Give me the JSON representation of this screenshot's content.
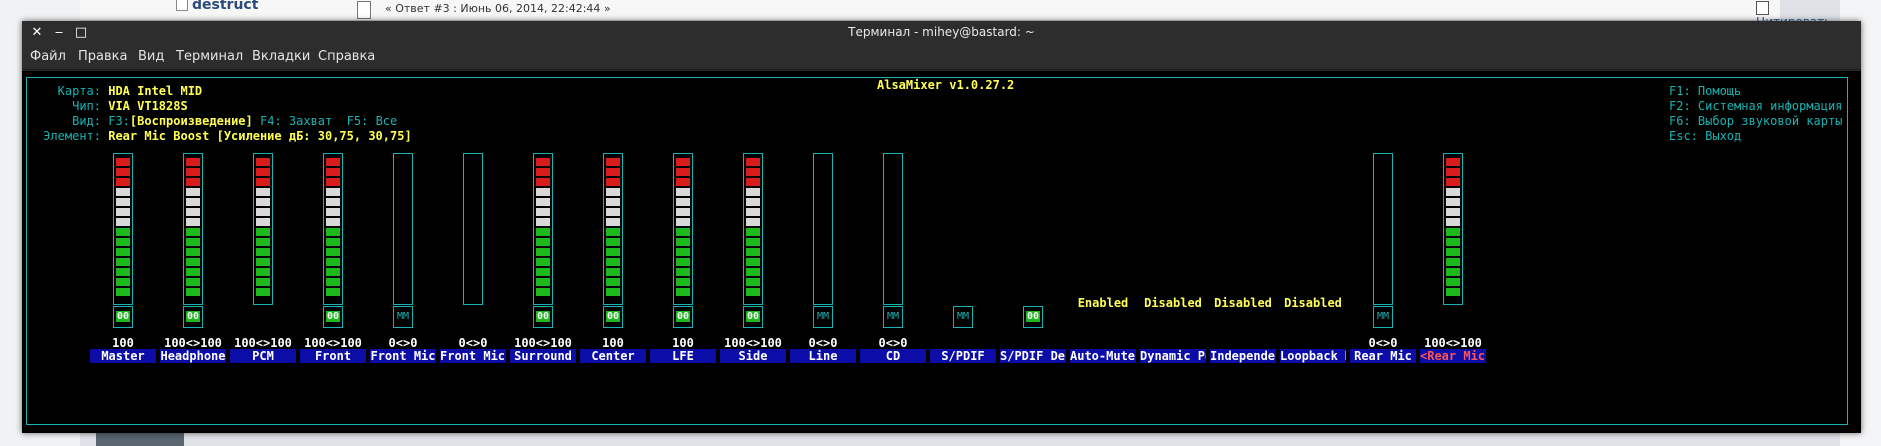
{
  "background": {
    "forum_user": "destruct",
    "post_ref": "« Ответ #3 : Июнь 06, 2014, 22:42:44 »",
    "quote_label": "Цитировать"
  },
  "window": {
    "title": "Терминал - mihey@bastard: ~",
    "close_glyph": "✕",
    "minimize_glyph": "‒",
    "maximize_glyph": "□"
  },
  "menu": [
    {
      "label": "Файл"
    },
    {
      "label": "Правка"
    },
    {
      "label": "Вид"
    },
    {
      "label": "Терминал"
    },
    {
      "label": "Вкладки"
    },
    {
      "label": "Справка"
    }
  ],
  "alsamixer": {
    "title": "AlsaMixer v1.0.27.2",
    "card_label": "Карта:",
    "card_value": "HDA Intel MID",
    "chip_label": "Чип:",
    "chip_value": "VIA VT1828S",
    "view_label": "Вид:",
    "view_f3": "F3:",
    "view_playback": "[Воспроизведение]",
    "view_rest": " F4: Захват  F5: Все",
    "element_label": "Элемент:",
    "element_value": "Rear Mic Boost [Усиление дБ: 30,75, 30,75]",
    "help": [
      "F1: Помощь",
      "F2: Системная информация",
      "F6: Выбор звуковой карты",
      "Esc: Выход"
    ]
  },
  "channels": [
    {
      "name": "Master",
      "value": "100",
      "mute": "00",
      "level": 1.0,
      "has_bar": true
    },
    {
      "name": "Headphone",
      "value": "100<>100",
      "mute": "00",
      "level": 1.0,
      "has_bar": true
    },
    {
      "name": "PCM",
      "value": "100<>100",
      "mute": "",
      "level": 1.0,
      "has_bar": true
    },
    {
      "name": "Front",
      "value": "100<>100",
      "mute": "00",
      "level": 1.0,
      "has_bar": true
    },
    {
      "name": "Front Mic",
      "value": "0<>0",
      "mute": "MM",
      "level": 0.0,
      "has_bar": true
    },
    {
      "name": "Front Mic B",
      "value": "0<>0",
      "mute": "",
      "level": 0.0,
      "has_bar": true
    },
    {
      "name": "Surround",
      "value": "100<>100",
      "mute": "00",
      "level": 1.0,
      "has_bar": true
    },
    {
      "name": "Center",
      "value": "100",
      "mute": "00",
      "level": 1.0,
      "has_bar": true
    },
    {
      "name": "LFE",
      "value": "100",
      "mute": "00",
      "level": 1.0,
      "has_bar": true
    },
    {
      "name": "Side",
      "value": "100<>100",
      "mute": "00",
      "level": 1.0,
      "has_bar": true
    },
    {
      "name": "Line",
      "value": "0<>0",
      "mute": "MM",
      "level": 0.0,
      "has_bar": true
    },
    {
      "name": "CD",
      "value": "0<>0",
      "mute": "MM",
      "level": 0.0,
      "has_bar": true
    },
    {
      "name": "S/PDIF",
      "value": "",
      "mute": "MM",
      "level": 0.0,
      "has_bar": false
    },
    {
      "name": "S/PDIF Defa",
      "value": "",
      "mute": "00",
      "level": 0.0,
      "has_bar": false
    },
    {
      "name": "Auto-Mute M",
      "value": "",
      "mute": "",
      "level": 0.0,
      "has_bar": false,
      "enum": "Enabled"
    },
    {
      "name": "Dynamic Pow",
      "value": "",
      "mute": "",
      "level": 0.0,
      "has_bar": false,
      "enum": "Disabled"
    },
    {
      "name": "Independent",
      "value": "",
      "mute": "",
      "level": 0.0,
      "has_bar": false,
      "enum": "Disabled"
    },
    {
      "name": "Loopback Mi",
      "value": "",
      "mute": "",
      "level": 0.0,
      "has_bar": false,
      "enum": "Disabled"
    },
    {
      "name": "Rear Mic",
      "value": "0<>0",
      "mute": "MM",
      "level": 0.0,
      "has_bar": true
    },
    {
      "name": "<Rear Mic Bo>",
      "value": "100<>100",
      "mute": "",
      "level": 1.0,
      "has_bar": true,
      "focused": true
    }
  ],
  "colors": {
    "terminal_bg": "#000000",
    "frame": "#18b2b2",
    "highlight": "#ffff54",
    "name_bg": "#0c0ca8",
    "focused_name": "#ff5454",
    "meter_red": "#d81c1c",
    "meter_white": "#d8d8d8",
    "meter_green": "#1cb81c"
  }
}
